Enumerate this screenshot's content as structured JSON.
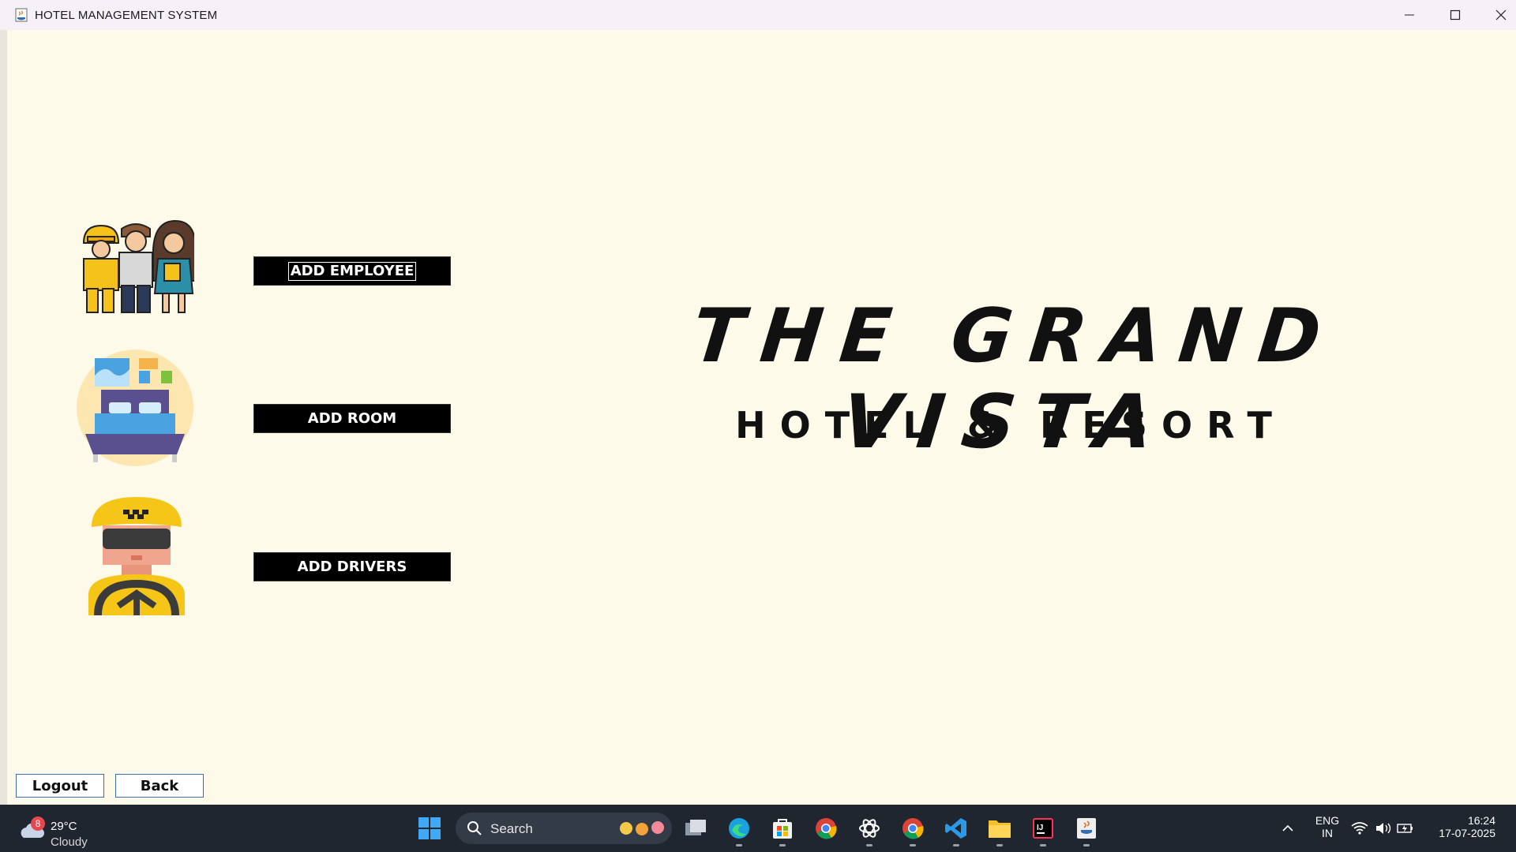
{
  "window": {
    "title": "HOTEL MANAGEMENT SYSTEM",
    "controls": [
      "minimize-icon",
      "maximize-icon",
      "close-icon"
    ]
  },
  "actions": {
    "add_employee": "ADD EMPLOYEE",
    "add_room": "ADD ROOM",
    "add_drivers": "ADD DRIVERS"
  },
  "illustrations": [
    "employees-illustration",
    "room-illustration",
    "driver-illustration"
  ],
  "brand": {
    "title": "THE GRAND VISTA",
    "subtitle": "HOTEL & RESORT"
  },
  "footer_buttons": {
    "logout": "Logout",
    "back": "Back"
  },
  "taskbar": {
    "weather": {
      "badge": "8",
      "temp": "29°C",
      "condition": "Cloudy"
    },
    "search_placeholder": "Search",
    "apps": [
      "windows-start-icon",
      "task-view-icon",
      "edge-icon",
      "store-icon",
      "chrome-icon",
      "chatgpt-icon",
      "chrome-icon",
      "vscode-icon",
      "file-explorer-icon",
      "intellij-icon",
      "java-icon"
    ],
    "tray": {
      "lang": "ENG",
      "region": "IN",
      "time": "16:24",
      "date": "17-07-2025"
    }
  }
}
